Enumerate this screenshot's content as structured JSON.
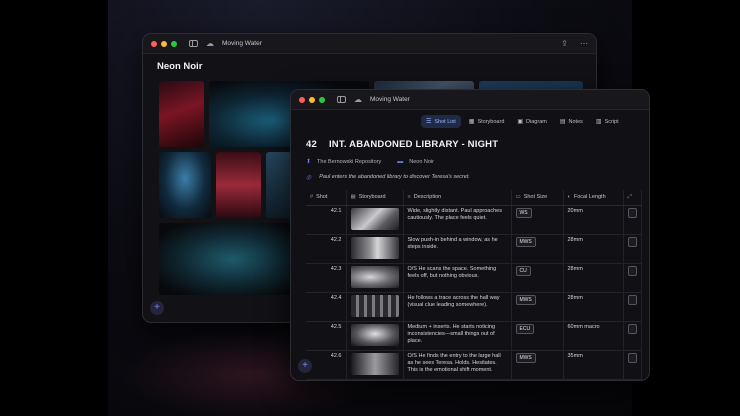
{
  "colors": {
    "accent": "#7d86ff",
    "active_tab_bg": "#1e2a46",
    "window_bg": "#101015"
  },
  "back_window": {
    "title": "Moving Water",
    "gallery_title": "Neon Noir",
    "icons": {
      "share": "share-icon",
      "more": "more-icon",
      "sidebar": "sidebar-icon",
      "cloud": "cloud-icon"
    }
  },
  "front_window": {
    "title": "Moving Water",
    "tabs": [
      {
        "label": "Shot List",
        "icon": "list-icon",
        "active": true
      },
      {
        "label": "Storyboard",
        "icon": "storyboard-icon",
        "active": false
      },
      {
        "label": "Diagram",
        "icon": "diagram-icon",
        "active": false
      },
      {
        "label": "Notes",
        "icon": "notes-icon",
        "active": false
      },
      {
        "label": "Script",
        "icon": "script-icon",
        "active": false
      }
    ],
    "scene": {
      "number": "42",
      "heading": "INT. ABANDONED LIBRARY - NIGHT",
      "location": "The Bernowski Repository",
      "mood": "Neon Noir",
      "summary": "Paul enters the abandoned library to discover Teresa's secret."
    },
    "columns": [
      "Shot",
      "Storyboard",
      "Description",
      "Shot Size",
      "Focal Length"
    ],
    "rows": [
      {
        "shot": "42.1",
        "description": "Wide, slightly distant. Paul approaches cautiously. The place feels quiet.",
        "size": "WS",
        "focal": "20mm"
      },
      {
        "shot": "42.2",
        "description": "Slow push-in behind a window, as he steps inside.",
        "size": "MWS",
        "focal": "28mm"
      },
      {
        "shot": "42.3",
        "description": "O/S He scans the space. Something feels off, but nothing obvious.",
        "size": "CU",
        "focal": "28mm"
      },
      {
        "shot": "42.4",
        "description": "He follows a trace across the hall way (visual clue leading somewhere).",
        "size": "MWS",
        "focal": "28mm"
      },
      {
        "shot": "42.5",
        "description": "Medium + inserts. He starts noticing inconsistencies—small things out of place.",
        "size": "ECU",
        "focal": "60mm macro"
      },
      {
        "shot": "42.6",
        "description": "O/S He finds the entry to the large hall as he sees Teresa. Holds. Hesitates. This is the emotional shift moment.",
        "size": "MWS",
        "focal": "35mm"
      }
    ]
  }
}
